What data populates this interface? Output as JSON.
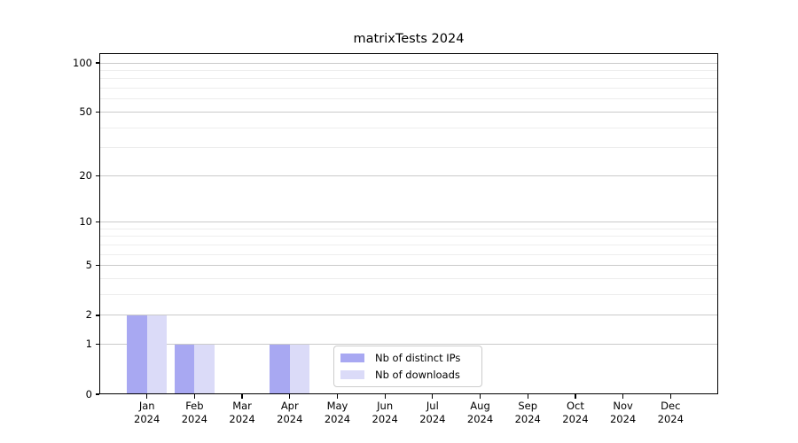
{
  "chart_data": {
    "type": "bar",
    "title": "matrixTests 2024",
    "categories": [
      {
        "month": "Jan",
        "year": "2024"
      },
      {
        "month": "Feb",
        "year": "2024"
      },
      {
        "month": "Mar",
        "year": "2024"
      },
      {
        "month": "Apr",
        "year": "2024"
      },
      {
        "month": "May",
        "year": "2024"
      },
      {
        "month": "Jun",
        "year": "2024"
      },
      {
        "month": "Jul",
        "year": "2024"
      },
      {
        "month": "Aug",
        "year": "2024"
      },
      {
        "month": "Sep",
        "year": "2024"
      },
      {
        "month": "Oct",
        "year": "2024"
      },
      {
        "month": "Nov",
        "year": "2024"
      },
      {
        "month": "Dec",
        "year": "2024"
      }
    ],
    "series": [
      {
        "name": "Nb of distinct IPs",
        "color": "#a8a8f2",
        "values": [
          2,
          1,
          0,
          1,
          0,
          0,
          0,
          0,
          0,
          0,
          0,
          0
        ]
      },
      {
        "name": "Nb of downloads",
        "color": "#dbdbf8",
        "values": [
          2,
          1,
          0,
          1,
          0,
          0,
          0,
          0,
          0,
          0,
          0,
          0
        ]
      }
    ],
    "y_axis": {
      "scale": "log1p",
      "ticks_major": [
        0,
        1,
        2,
        5,
        10,
        20,
        50,
        100
      ],
      "ticks_minor": [
        3,
        4,
        6,
        7,
        8,
        9,
        30,
        40,
        60,
        70,
        80,
        90
      ],
      "range": [
        0,
        115
      ]
    },
    "xlabel": "",
    "ylabel": "",
    "legend": {
      "position": "lower center-left inside plot",
      "border_color": "#cccccc",
      "background": "#ffffff"
    },
    "grid": {
      "major_color": "#cacaca",
      "minor_color": "#ededed",
      "enabled": true
    }
  }
}
